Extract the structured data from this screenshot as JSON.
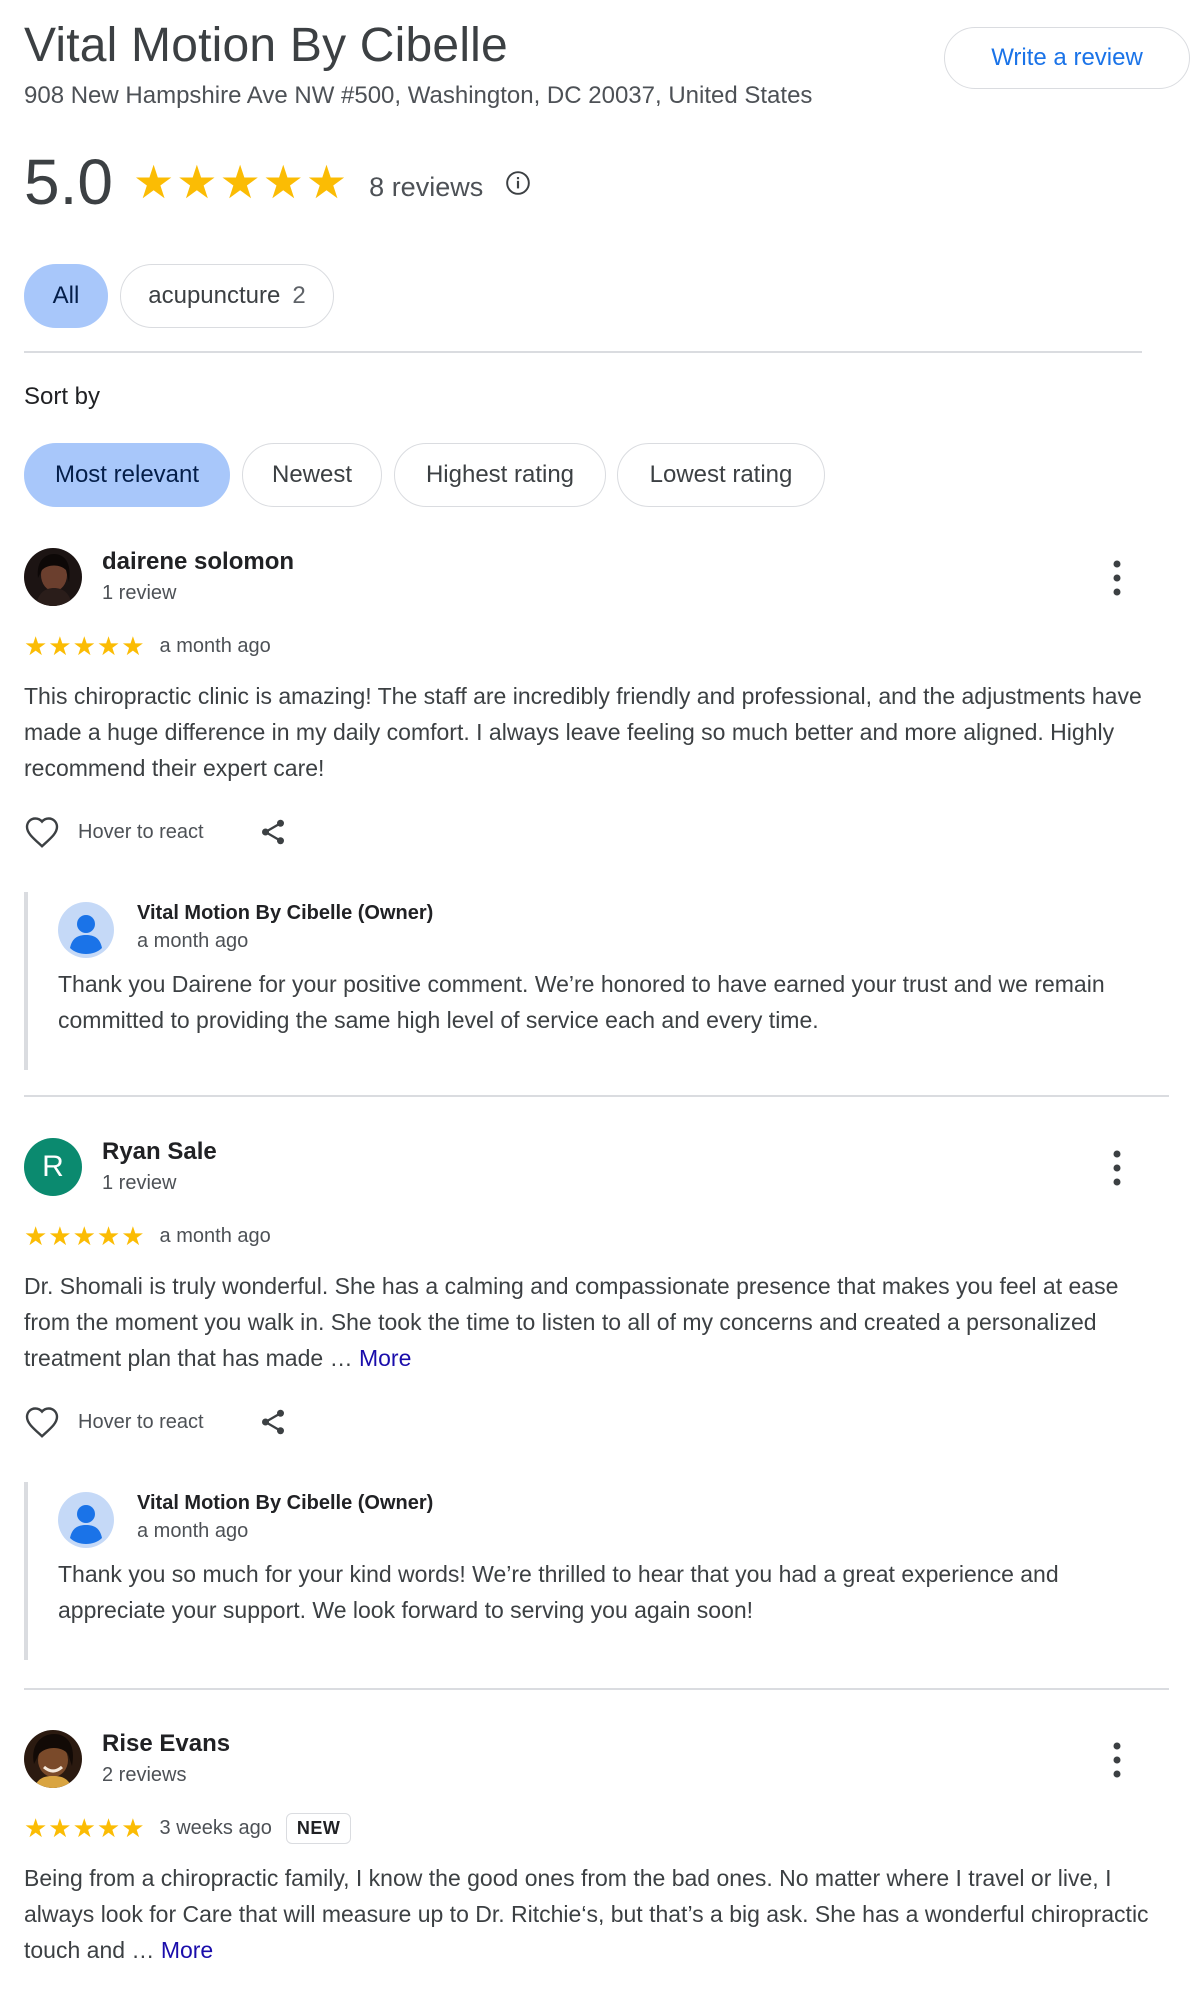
{
  "header": {
    "business_name": "Vital Motion By Cibelle",
    "address": "908 New Hampshire Ave NW #500, Washington, DC 20037, United States",
    "write_review_label": "Write a review"
  },
  "summary": {
    "rating": "5.0",
    "stars": "★★★★★",
    "star_count": 5,
    "reviews_label": "8 reviews",
    "info_icon": "info-icon"
  },
  "filters": [
    {
      "label": "All",
      "count": "",
      "active": true
    },
    {
      "label": "acupuncture",
      "count": "2",
      "active": false
    }
  ],
  "sort": {
    "label": "Sort by",
    "options": [
      {
        "label": "Most relevant",
        "active": true
      },
      {
        "label": "Newest",
        "active": false
      },
      {
        "label": "Highest rating",
        "active": false
      },
      {
        "label": "Lowest rating",
        "active": false
      }
    ]
  },
  "colors": {
    "star": "#fbbc04",
    "active_chip": "#a8c7fa",
    "link": "#1a73e8",
    "more_link": "#1a0dab",
    "letter_avatar": "#0b8a6f"
  },
  "reviews": [
    {
      "author": "dairene solomon",
      "meta": "1 review",
      "stars": "★★★★★",
      "rating": 5,
      "when": "a month ago",
      "text": "This chiropractic clinic is amazing! The staff are incredibly friendly and professional, and the adjustments have made a huge difference in my daily comfort. I always leave feeling so much better and more aligned. Highly recommend their expert care!",
      "more": "",
      "react_label": "Hover to react",
      "owner_reply": {
        "name": "Vital Motion By Cibelle (Owner)",
        "when": "a month ago",
        "text": "Thank you Dairene for your positive comment. We’re honored to have earned your trust and we remain committed to providing the same high level of service each and every time."
      }
    },
    {
      "author": "Ryan Sale",
      "avatar_letter": "R",
      "meta": "1 review",
      "stars": "★★★★★",
      "rating": 5,
      "when": "a month ago",
      "text": "Dr. Shomali is truly wonderful. She has a calming and compassionate presence that makes you feel at ease from the moment you walk in. She took the time to listen to all of my concerns and created a personalized treatment plan that has made …",
      "more": "More",
      "react_label": "Hover to react",
      "owner_reply": {
        "name": "Vital Motion By Cibelle (Owner)",
        "when": "a month ago",
        "text": "Thank you so much for your kind words! We’re thrilled to hear that you had a great experience and appreciate your support. We look forward to serving you again soon!"
      }
    },
    {
      "author": "Rise Evans",
      "meta": "2 reviews",
      "stars": "★★★★★",
      "rating": 5,
      "when": "3 weeks ago",
      "badge": "NEW",
      "text": "Being from a chiropractic family, I know the good ones from the bad ones. No matter where I travel or live, I always look for Care that will measure up to Dr. Ritchie‘s, but that’s a big ask. She has a wonderful chiropractic touch and …",
      "more": "More"
    }
  ]
}
